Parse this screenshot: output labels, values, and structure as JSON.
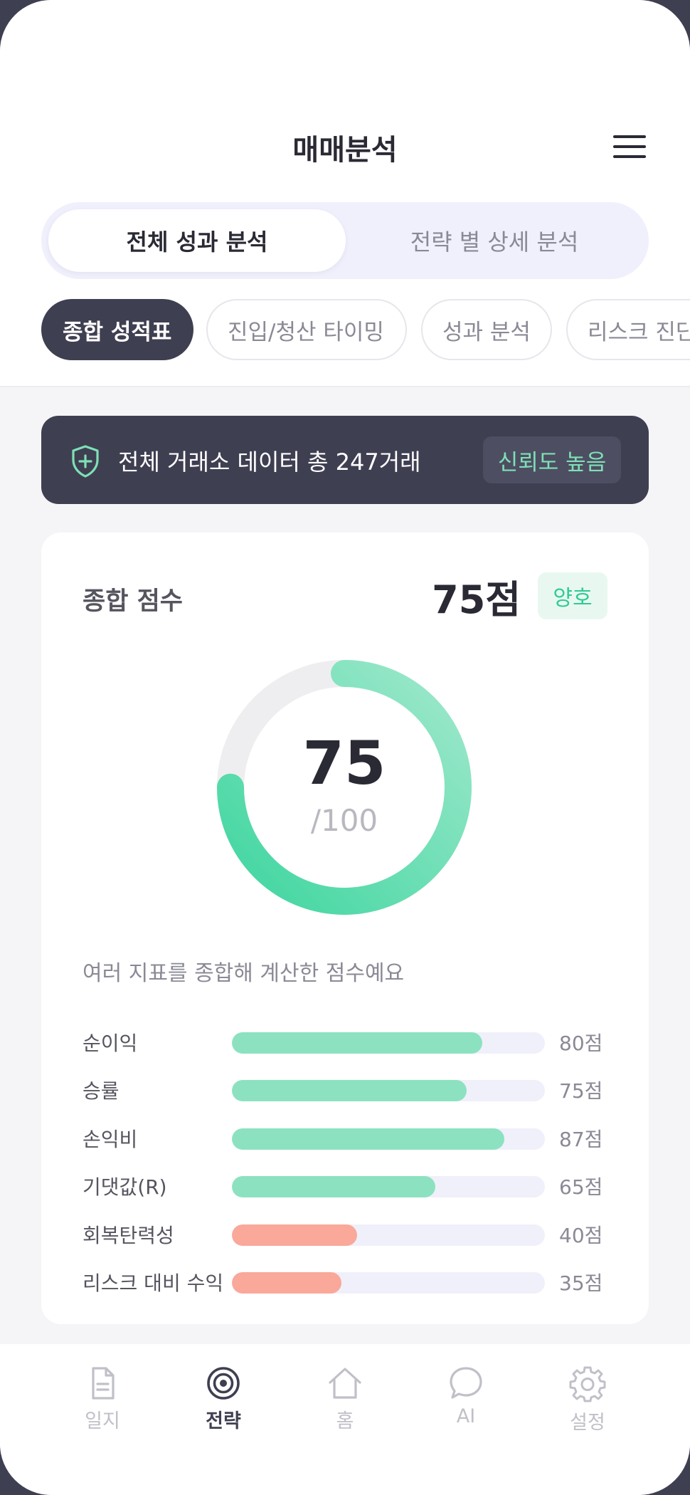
{
  "header": {
    "title": "매매분석",
    "menu_icon": "menu-icon"
  },
  "segment": {
    "tabs": [
      {
        "label": "전체 성과 분석",
        "active": true
      },
      {
        "label": "전략 별 상세 분석",
        "active": false
      }
    ]
  },
  "chips": [
    {
      "label": "종합 성적표",
      "active": true
    },
    {
      "label": "진입/청산 타이밍",
      "active": false
    },
    {
      "label": "성과 분석",
      "active": false
    },
    {
      "label": "리스크 진단",
      "active": false
    }
  ],
  "banner": {
    "icon": "shield-plus-icon",
    "text": "전체 거래소 데이터 총 247거래",
    "badge": "신뢰도 높음"
  },
  "score_card": {
    "title": "종합 점수",
    "score_text": "75점",
    "grade": "양호",
    "ring_value": "75",
    "ring_max": "/100",
    "ring_fraction": 0.75,
    "description": "여러 지표를 종합해 계산한 점수예요",
    "metrics": [
      {
        "label": "순이익",
        "value": "80점",
        "score": 80,
        "color": "#8ce2c0"
      },
      {
        "label": "승률",
        "value": "75점",
        "score": 75,
        "color": "#8ce2c0"
      },
      {
        "label": "손익비",
        "value": "87점",
        "score": 87,
        "color": "#8ce2c0"
      },
      {
        "label": "기댓값(R)",
        "value": "65점",
        "score": 65,
        "color": "#8ce2c0"
      },
      {
        "label": "회복탄력성",
        "value": "40점",
        "score": 40,
        "color": "#f9a89a"
      },
      {
        "label": "리스크 대비 수익",
        "value": "35점",
        "score": 35,
        "color": "#f9a89a"
      }
    ]
  },
  "colors": {
    "accent": "#2fcb93",
    "dark": "#3f3f52",
    "good": "#8ce2c0",
    "bad": "#f9a89a"
  },
  "nav": [
    {
      "label": "일지",
      "icon": "document-icon",
      "active": false
    },
    {
      "label": "전략",
      "icon": "target-icon",
      "active": true
    },
    {
      "label": "홈",
      "icon": "home-icon",
      "active": false
    },
    {
      "label": "AI",
      "icon": "chat-bubble-icon",
      "active": false
    },
    {
      "label": "설정",
      "icon": "gear-icon",
      "active": false
    }
  ]
}
